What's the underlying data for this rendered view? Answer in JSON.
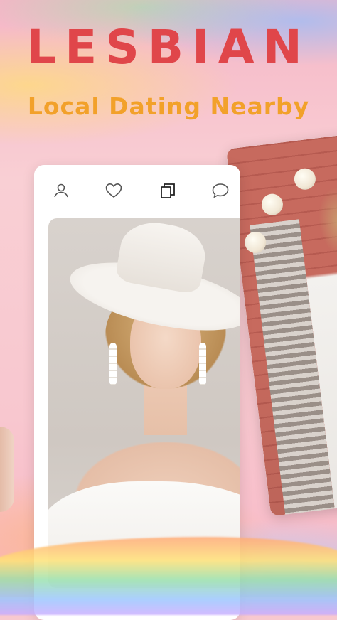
{
  "header": {
    "title": "LESBIAN",
    "subtitle": "Local Dating Nearby"
  },
  "tabs": [
    {
      "icon": "profile-icon"
    },
    {
      "icon": "heart-icon"
    },
    {
      "icon": "cards-icon"
    },
    {
      "icon": "chat-icon"
    }
  ],
  "colors": {
    "title": "#e0464a",
    "subtitle": "#f2a12a",
    "background": "#f8c9cf"
  }
}
